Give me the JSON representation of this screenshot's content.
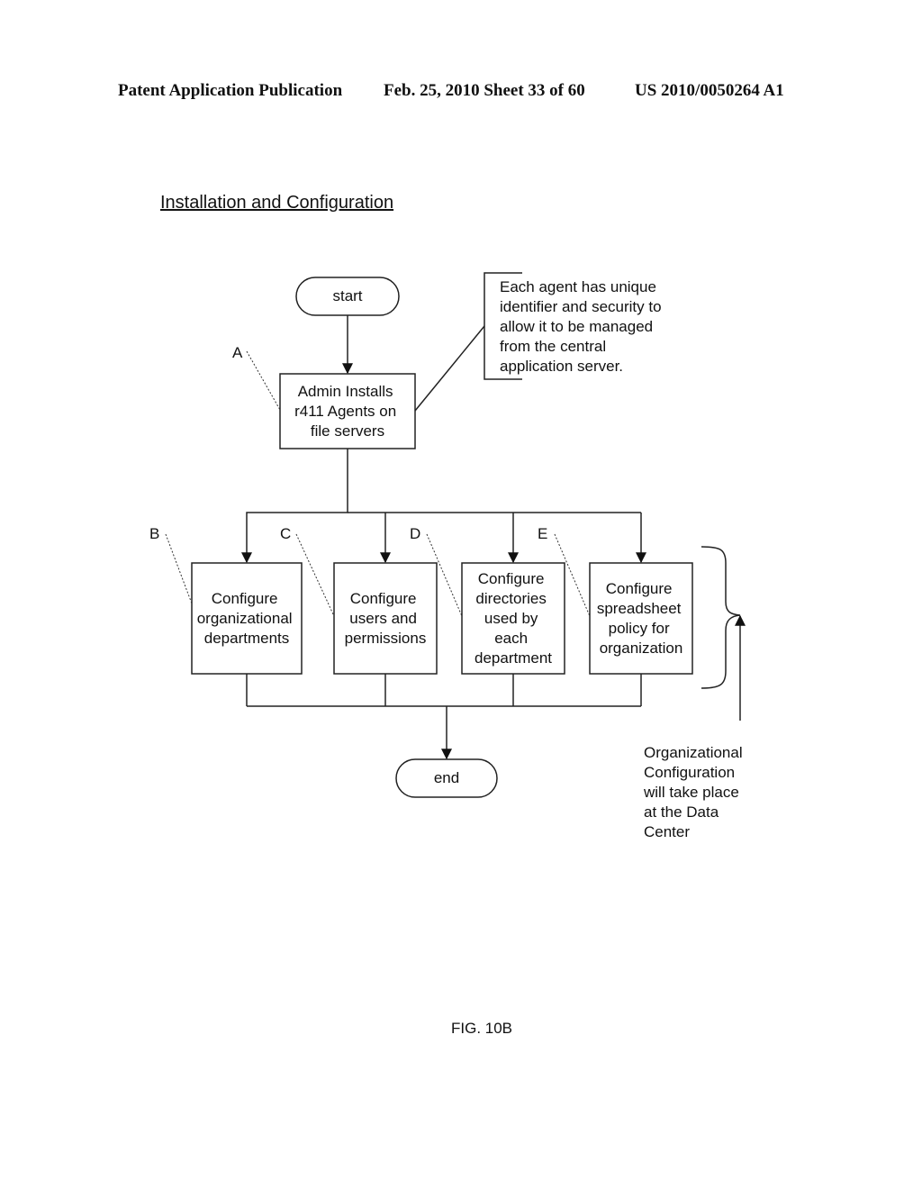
{
  "header": {
    "left": "Patent Application Publication",
    "middle": "Feb. 25, 2010  Sheet 33 of 60",
    "right": "US 2010/0050264 A1"
  },
  "title": "Installation and Configuration",
  "figure_label": "FIG. 10B",
  "diagram": {
    "start": "start",
    "end": "end",
    "install_step": {
      "label": "A",
      "lines": [
        "Admin Installs",
        "r411 Agents on",
        "file servers"
      ]
    },
    "install_note": {
      "lines": [
        "Each agent has unique",
        "identifier and security to",
        "allow it to be managed",
        "from the central",
        "application server."
      ]
    },
    "config_steps": [
      {
        "label": "B",
        "lines": [
          "Configure",
          "organizational",
          "departments"
        ]
      },
      {
        "label": "C",
        "lines": [
          "Configure",
          "users and",
          "permissions"
        ]
      },
      {
        "label": "D",
        "lines": [
          "Configure",
          "directories",
          "used by",
          "each",
          "department"
        ]
      },
      {
        "label": "E",
        "lines": [
          "Configure",
          "spreadsheet",
          "policy for",
          "organization"
        ]
      }
    ],
    "org_note": {
      "lines": [
        "Organizational",
        "Configuration",
        "will take place",
        "at the  Data",
        "Center"
      ]
    }
  }
}
